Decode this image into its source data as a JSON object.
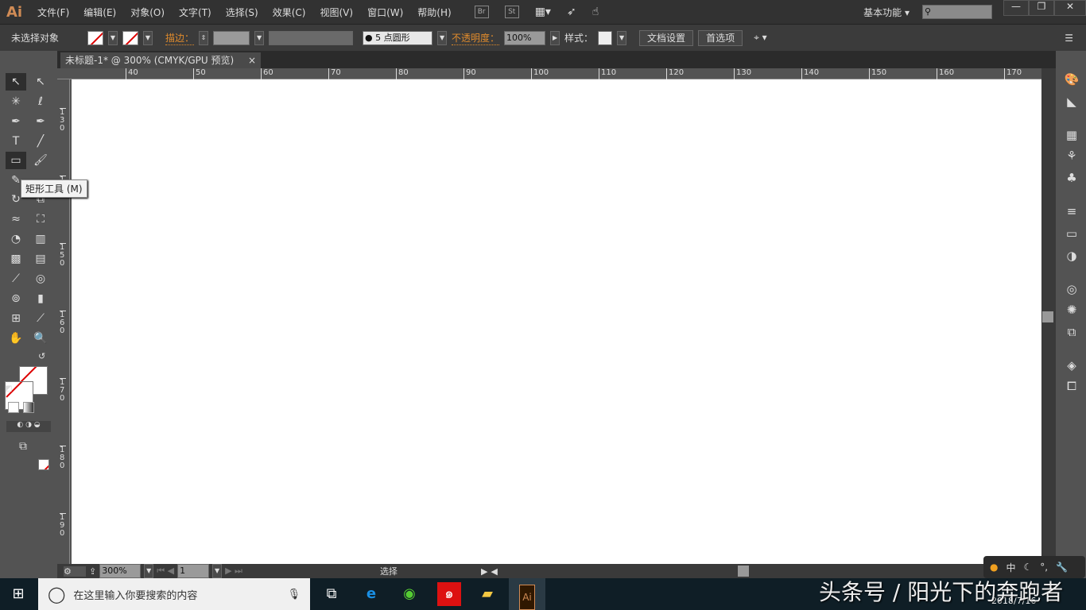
{
  "app": {
    "logo": "Ai"
  },
  "menu": [
    "文件(F)",
    "编辑(E)",
    "对象(O)",
    "文字(T)",
    "选择(S)",
    "效果(C)",
    "视图(V)",
    "窗口(W)",
    "帮助(H)"
  ],
  "app_icons": {
    "bridge": "Br",
    "stock": "St"
  },
  "workspace": {
    "label": "基本功能",
    "search_placeholder": ""
  },
  "control": {
    "selection": "未选择对象",
    "stroke_label": "描边：",
    "brush": "5 点圆形",
    "opacity_label": "不透明度：",
    "opacity": "100%",
    "style_label": "样式：",
    "doc_setup": "文档设置",
    "preferences": "首选项"
  },
  "document": {
    "tab": "未标题-1* @ 300% (CMYK/GPU 预览)",
    "close": "×"
  },
  "ruler": {
    "h": [
      "40",
      "50",
      "60",
      "70",
      "80",
      "90",
      "100",
      "110",
      "120",
      "130",
      "140",
      "150",
      "160",
      "170"
    ],
    "v": [
      "130",
      "140",
      "150",
      "160",
      "170",
      "180",
      "190"
    ]
  },
  "tooltip": "矩形工具 (M)",
  "status": {
    "zoom": "300%",
    "page": "1",
    "mode": "选择"
  },
  "taskbar": {
    "search": "在这里输入你要搜索的内容",
    "date": "2018/7/16",
    "ime": "中"
  },
  "watermark": "头条号 / 阳光下的奔跑者"
}
